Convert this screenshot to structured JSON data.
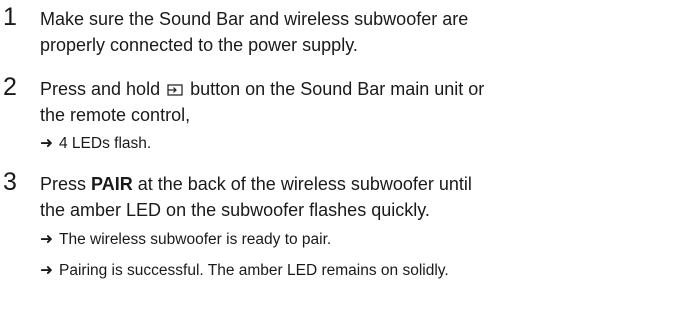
{
  "steps": [
    {
      "number": "1",
      "line1": "Make sure the Sound Bar and wireless subwoofer are",
      "line2": "properly connected to the power supply."
    },
    {
      "number": "2",
      "line1_before": "Press and hold",
      "line1_after": "button on the Sound Bar main unit or",
      "line2": "the remote control,",
      "icon": "source-input-icon",
      "results": [
        "4 LEDs flash."
      ]
    },
    {
      "number": "3",
      "line1_before": "Press",
      "line1_bold": "PAIR",
      "line1_after": "at the back of the wireless subwoofer until",
      "line2": "the amber LED on the subwoofer flashes quickly.",
      "results": [
        "The wireless subwoofer is ready to pair.",
        "Pairing is successful. The amber LED remains on solidly."
      ]
    }
  ],
  "arrow_symbol": "➜"
}
